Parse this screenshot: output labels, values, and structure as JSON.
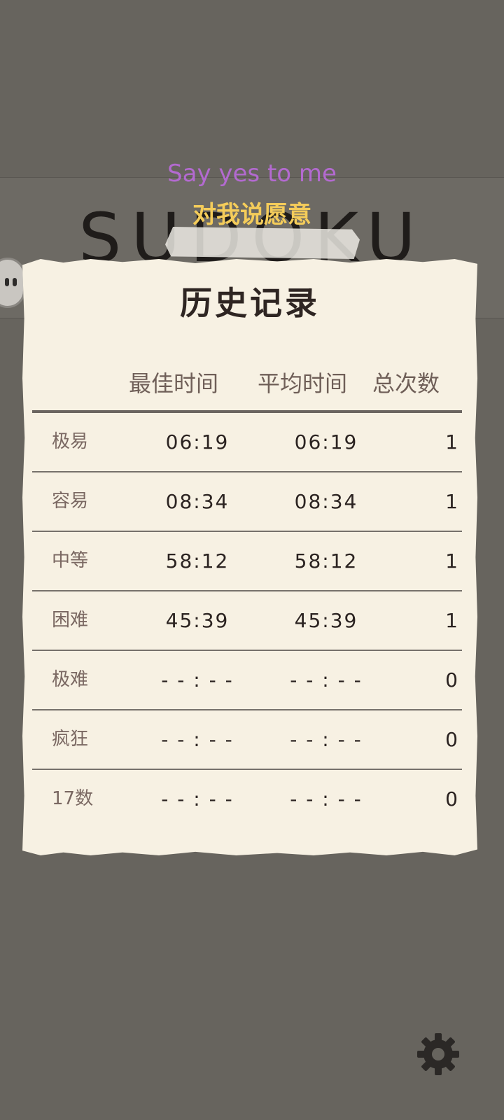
{
  "background": {
    "app_title": "SUDOKU"
  },
  "lyrics": {
    "english": "Say yes to me",
    "chinese": "对我说愿意"
  },
  "history": {
    "title": "历史记录",
    "columns": {
      "best": "最佳时间",
      "average": "平均时间",
      "count": "总次数"
    },
    "rows": [
      {
        "level": "极易",
        "best": "06:19",
        "average": "06:19",
        "count": "1"
      },
      {
        "level": "容易",
        "best": "08:34",
        "average": "08:34",
        "count": "1"
      },
      {
        "level": "中等",
        "best": "58:12",
        "average": "58:12",
        "count": "1"
      },
      {
        "level": "困难",
        "best": "45:39",
        "average": "45:39",
        "count": "1"
      },
      {
        "level": "极难",
        "best": "- - : - -",
        "average": "- - : - -",
        "count": "0"
      },
      {
        "level": "疯狂",
        "best": "- - : - -",
        "average": "- - : - -",
        "count": "0"
      },
      {
        "level": "17数",
        "best": "- - : - -",
        "average": "- - : - -",
        "count": "0"
      }
    ]
  },
  "icons": {
    "settings": "gear-icon",
    "floating": "voice-assistant-icon"
  },
  "colors": {
    "backdrop": "#67645e",
    "paper": "#f7f1e3",
    "lyric_english": "#b36ad0",
    "lyric_chinese": "#f4cc5a"
  }
}
